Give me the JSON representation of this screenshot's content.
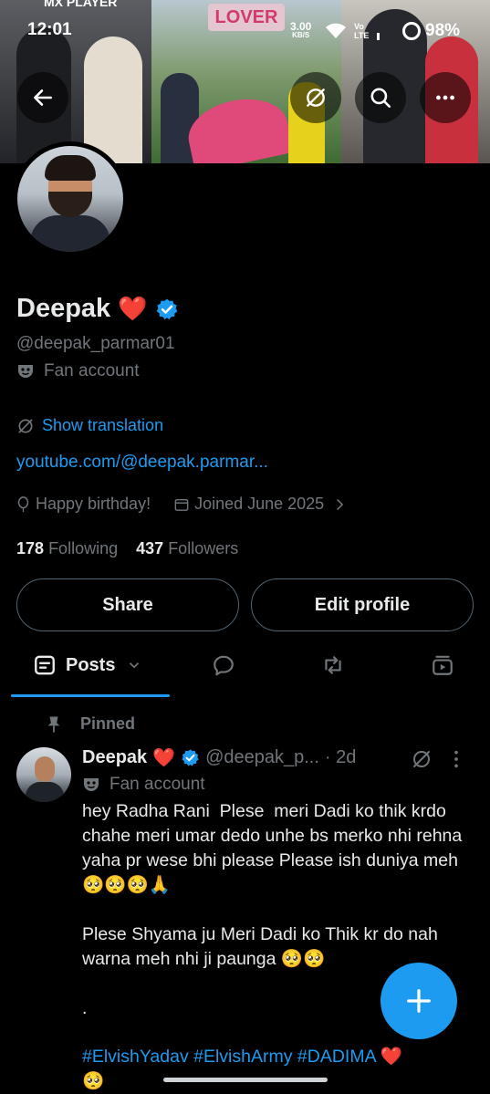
{
  "status_bar": {
    "time": "12:01",
    "net_speed": "3.00",
    "net_unit": "KB/S",
    "volte_top": "Vo",
    "volte_bottom": "LTE",
    "battery": "98%"
  },
  "banner": {
    "left_brand": "MX PLAYER",
    "center_title": "LOVER"
  },
  "profile": {
    "name": "Deepak",
    "name_emoji": "❤️",
    "handle": "@deepak_parmar01",
    "label": "Fan account",
    "show_translation": "Show translation",
    "link": "youtube.com/@deepak.parmar...",
    "birthday": "Happy birthday!",
    "joined": "Joined June 2025",
    "following_count": "178",
    "following_label": "Following",
    "followers_count": "437",
    "followers_label": "Followers"
  },
  "buttons": {
    "share": "Share",
    "edit_profile": "Edit profile"
  },
  "tabs": {
    "posts": "Posts"
  },
  "post": {
    "pinned_label": "Pinned",
    "author": "Deepak",
    "author_emoji": "❤️",
    "handle": "@deepak_p...",
    "time": "· 2d",
    "label": "Fan account",
    "body": "hey Radha Rani  Plese  meri Dadi ko thik krdo  chahe meri umar dedo unhe bs merko nhi rehna yaha pr wese bhi please Please ish duniya meh 🥺🥺🥺🙏\n\nPlese Shyama ju Meri Dadi ko Thik kr do nah warna meh nhi ji paunga 🥺🥺\n\n.",
    "hashtags": "#ElvishYadav #ElvishArmy #DADIMA",
    "hashtags_tail": " ❤️\n🥺"
  },
  "colors": {
    "accent": "#1d9bf0",
    "muted": "#71767b",
    "text": "#e7e9ea",
    "background": "#000000"
  }
}
